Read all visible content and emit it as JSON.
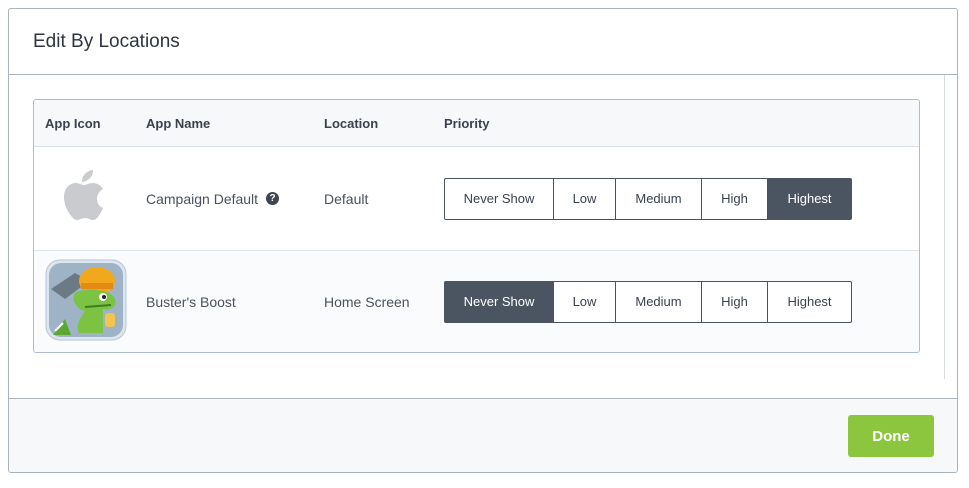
{
  "dialog": {
    "title": "Edit By Locations",
    "done_label": "Done"
  },
  "table": {
    "headers": {
      "icon": "App Icon",
      "name": "App Name",
      "location": "Location",
      "priority": "Priority"
    },
    "priority_options": [
      "Never Show",
      "Low",
      "Medium",
      "High",
      "Highest"
    ],
    "rows": [
      {
        "icon": "apple-logo-icon",
        "name": "Campaign Default",
        "has_help": true,
        "location": "Default",
        "priority": "Highest"
      },
      {
        "icon": "busters-boost-app-icon",
        "name": "Buster's Boost",
        "has_help": false,
        "location": "Home Screen",
        "priority": "Never Show"
      }
    ]
  },
  "colors": {
    "accent_done": "#8cc63e",
    "selected_segment": "#4b5562"
  }
}
